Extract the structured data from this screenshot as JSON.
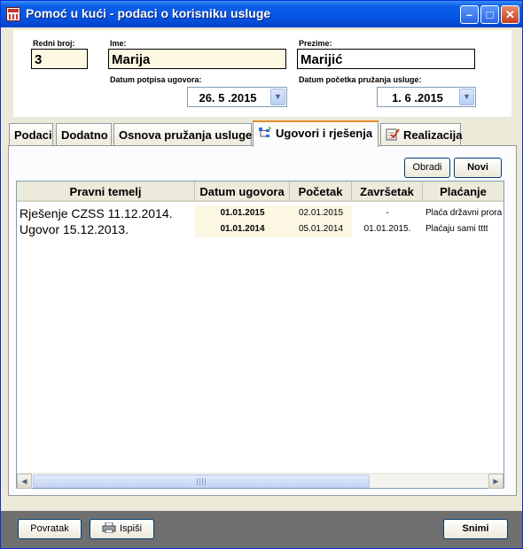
{
  "window": {
    "title": "Pomoć u kući - podaci o korisniku usluge"
  },
  "header": {
    "redni_broj_label": "Redni broj:",
    "redni_broj_value": "3",
    "ime_label": "Ime:",
    "ime_value": "Marija",
    "prezime_label": "Prezime:",
    "prezime_value": "Marijić",
    "datum_potpisa_label": "Datum potpisa ugovora:",
    "datum_potpisa_value": "26. 5 .2015",
    "datum_pocetka_label": "Datum početka pružanja usluge:",
    "datum_pocetka_value": "1. 6 .2015"
  },
  "tabs": [
    {
      "label": "Podaci"
    },
    {
      "label": "Dodatno"
    },
    {
      "label": "Osnova pružanja usluge"
    },
    {
      "label": "Ugovori i rješenja",
      "active": true
    },
    {
      "label": "Realizacija"
    }
  ],
  "actions": {
    "obradi_label": "Obradi",
    "novi_label": "Novi"
  },
  "table": {
    "columns": [
      "Pravni temelj",
      "Datum ugovora",
      "Početak",
      "Završetak",
      "Plaćanje"
    ],
    "rows": [
      {
        "pravni_temelj": "Rješenje CZSS 11.12.2014.",
        "datum_ugovora": "01.01.2015",
        "pocetak": "02.01.2015",
        "zavrsetak": "-",
        "placanje": "Plaća državni prora"
      },
      {
        "pravni_temelj": "Ugovor 15.12.2013.",
        "datum_ugovora": "01.01.2014",
        "pocetak": "05.01.2014",
        "zavrsetak": "01.01.2015.",
        "placanje": "Plaćaju sami  tttt"
      }
    ]
  },
  "footer": {
    "povratak_label": "Povratak",
    "ispisi_label": "Ispiši",
    "snimi_label": "Snimi"
  }
}
